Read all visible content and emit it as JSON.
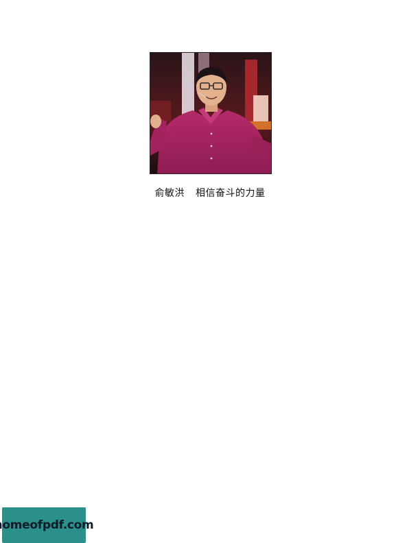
{
  "caption": {
    "author": "俞敏洪",
    "title": "相信奋斗的力量"
  },
  "watermark": {
    "text": "homeofpdf.com"
  },
  "colors": {
    "watermark_bg": "#2b8f8a",
    "shirt": "#a3235f"
  }
}
